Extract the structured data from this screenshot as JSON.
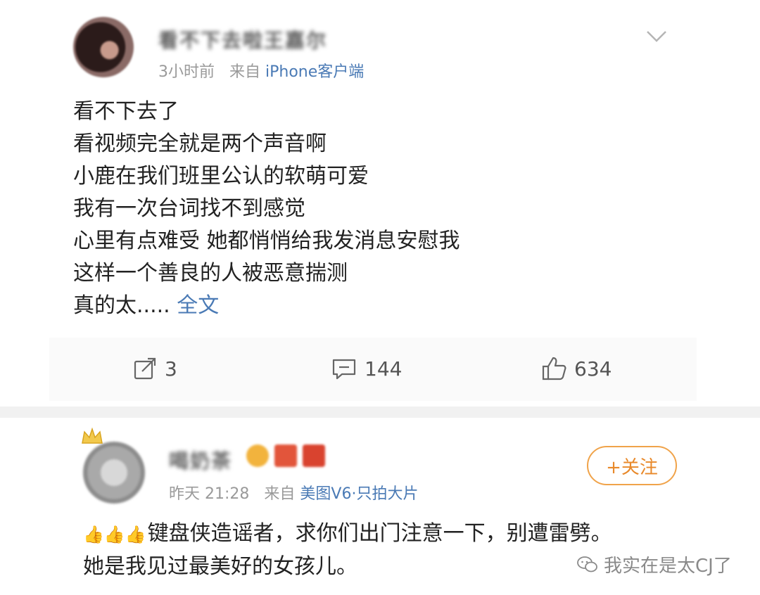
{
  "post": {
    "author_name": "看不下去啦王嘉尔",
    "time": "3小时前",
    "source_prefix": "来自",
    "source": "iPhone客户端",
    "lines": [
      "看不下去了",
      "看视频完全就是两个声音啊",
      "小鹿在我们班里公认的软萌可爱",
      "我有一次台词找不到感觉",
      "心里有点难受 她都悄悄给我发消息安慰我",
      "这样一个善良的人被恶意揣测"
    ],
    "last_line_prefix": "真的太.....",
    "full_text_link": "全文",
    "repost_count": "3",
    "comment_count": "144",
    "like_count": "634"
  },
  "comment": {
    "author_name": "喝奶茶",
    "time": "昨天 21:28",
    "source_prefix": "来自",
    "source": "美图V6·只拍大片",
    "follow_label": "+关注",
    "thumbs": "👍👍👍",
    "line1": "键盘侠造谣者，求你们出门注意一下，别遭雷劈。",
    "line2": "她是我见过最美好的女孩儿。"
  },
  "watermark": {
    "text": "我实在是太CJ了",
    "icon": "wechat-icon"
  },
  "colors": {
    "link": "#4a7ab5",
    "follow": "#e8892a",
    "meta": "#9a9a9a"
  }
}
